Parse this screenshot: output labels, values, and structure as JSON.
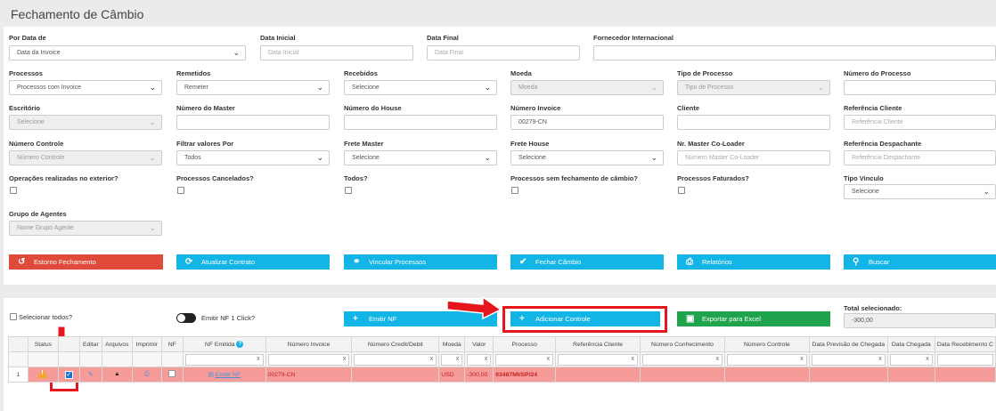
{
  "page": {
    "title": "Fechamento de Câmbio"
  },
  "filters": {
    "por_data": {
      "label": "Por Data de",
      "value": "Data da Invoice"
    },
    "data_inicial": {
      "label": "Data Inicial",
      "placeholder": "Data Inicial"
    },
    "data_final": {
      "label": "Data Final",
      "placeholder": "Data Final"
    },
    "fornecedor": {
      "label": "Fornecedor Internacional",
      "value": ""
    },
    "processos": {
      "label": "Processos",
      "value": "Processos com Invoice"
    },
    "remetidos": {
      "label": "Remetidos",
      "value": "Remeter"
    },
    "recebidos": {
      "label": "Recebidos",
      "value": "Selecione"
    },
    "moeda": {
      "label": "Moeda",
      "value": "Moeda"
    },
    "tipo_processo": {
      "label": "Tipo de Processo",
      "value": "Tipo de Processo"
    },
    "numero_processo": {
      "label": "Número do Processo",
      "value": ""
    },
    "escritorio": {
      "label": "Escritório",
      "value": "Selecione"
    },
    "numero_master": {
      "label": "Número do Master",
      "value": ""
    },
    "numero_house": {
      "label": "Número do House",
      "value": ""
    },
    "numero_invoice": {
      "label": "Número Invoice",
      "value": "00279-CN"
    },
    "cliente": {
      "label": "Cliente",
      "value": ""
    },
    "referencia_cliente": {
      "label": "Referência Cliente",
      "placeholder": "Referência Cliente"
    },
    "numero_controle": {
      "label": "Número Controle",
      "value": "Número Controle"
    },
    "filtrar_valores": {
      "label": "Filtrar valores Por",
      "value": "Todos"
    },
    "frete_master": {
      "label": "Frete Master",
      "value": "Selecione"
    },
    "frete_house": {
      "label": "Frete House",
      "value": "Selecione"
    },
    "nr_master_coloader": {
      "label": "Nr. Master Co-Loader",
      "placeholder": "Número Master Co-Loader"
    },
    "referencia_despachante": {
      "label": "Referência Despachante",
      "placeholder": "Referência Despachante"
    },
    "op_exterior": {
      "label": "Operações realizadas no exterior?"
    },
    "proc_cancelados": {
      "label": "Processos Cancelados?"
    },
    "todos": {
      "label": "Todos?"
    },
    "sem_fechamento": {
      "label": "Processos sem fechamento de câmbio?"
    },
    "faturados": {
      "label": "Processos Faturados?"
    },
    "tipo_vinculo": {
      "label": "Tipo Vinculo",
      "value": "Selecione"
    },
    "grupo_agentes": {
      "label": "Grupo de Agentes",
      "value": "Nome Grupo Agente"
    }
  },
  "actions": {
    "estorno": "Estorno Fechamento",
    "atualizar": "Atualizar Contrato",
    "vincular": "Vincular Processos",
    "fechar": "Fechar Câmbio",
    "relatorios": "Relatórios",
    "buscar": "Buscar"
  },
  "grid_toolbar": {
    "selecionar_todos": "Selecionar todos?",
    "emitir_nf_click": "Emitir NF 1 Click?",
    "emitir_nf": "Emitir NF",
    "adicionar_controle": "Adicionar Controle",
    "exportar_excel": "Exportar para Excel",
    "total_label": "Total selecionado:",
    "total_value": "-300,00"
  },
  "table": {
    "columns": [
      "Status",
      "Editar",
      "Arquivos",
      "Imprimir",
      "NF",
      "NF Emitida",
      "Número Invoice",
      "Número Credit/Debit",
      "Moeda",
      "Valor",
      "Processo",
      "Referência Cliente",
      "Número Conhecimento",
      "Número Controle",
      "Data Previsão de Chegada",
      "Data Chegada",
      "Data Recebimento C"
    ],
    "rows": [
      {
        "index": "1",
        "nf_emitida": "Emitir NF",
        "numero_invoice": "00279-CN",
        "credit_debit": "",
        "moeda": "USD",
        "valor": "-300,00",
        "processo": "03487MI/SP/24"
      }
    ]
  },
  "colors": {
    "red": "#e04a3a",
    "blue": "#13b4e6",
    "green": "#1fa34c",
    "row_highlight": "#f59c9b",
    "annotation": "#e5161c"
  }
}
